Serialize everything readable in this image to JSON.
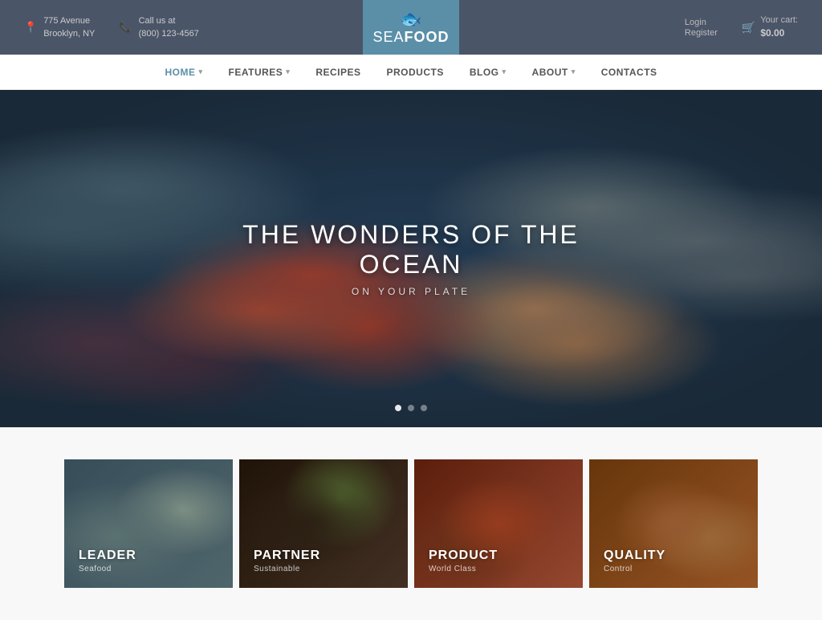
{
  "topbar": {
    "address_line1": "775 Avenue",
    "address_line2": "Brooklyn, NY",
    "phone_label": "Call us at",
    "phone_number": "(800) 123-4567",
    "login_label": "Login",
    "register_label": "Register",
    "cart_label": "Your cart:",
    "cart_price": "$0.00"
  },
  "logo": {
    "sea": "SEA",
    "food": "FOOD"
  },
  "nav": {
    "items": [
      {
        "label": "HOME",
        "has_dropdown": true,
        "active": true
      },
      {
        "label": "FEATURES",
        "has_dropdown": true,
        "active": false
      },
      {
        "label": "RECIPES",
        "has_dropdown": false,
        "active": false
      },
      {
        "label": "PRODUCTS",
        "has_dropdown": false,
        "active": false
      },
      {
        "label": "BLOG",
        "has_dropdown": true,
        "active": false
      },
      {
        "label": "ABOUT",
        "has_dropdown": true,
        "active": false
      },
      {
        "label": "CONTACTS",
        "has_dropdown": false,
        "active": false
      }
    ]
  },
  "hero": {
    "title": "THE WONDERS OF THE OCEAN",
    "subtitle": "ON YOUR PLATE",
    "dots": [
      {
        "active": true
      },
      {
        "active": false
      },
      {
        "active": false
      }
    ]
  },
  "categories": [
    {
      "id": "leader",
      "title": "LEADER",
      "subtitle": "Seafood"
    },
    {
      "id": "partner",
      "title": "PARTNER",
      "subtitle": "Sustainable"
    },
    {
      "id": "product",
      "title": "PRODUCT",
      "subtitle": "World Class"
    },
    {
      "id": "quality",
      "title": "QUALITY",
      "subtitle": "Control"
    }
  ]
}
